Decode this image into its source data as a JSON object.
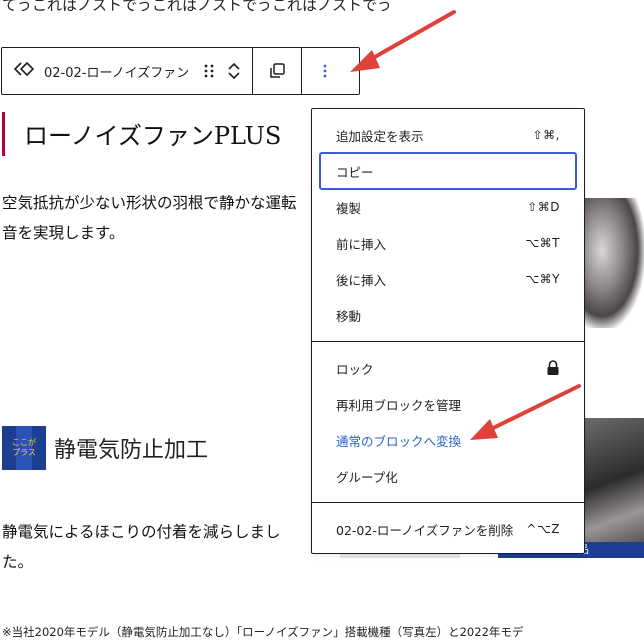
{
  "content": {
    "top_text": "てうこれはノストでうこれはノストでうこれはノストでう",
    "heading": "ローノイズファンPLUS",
    "paragraph1": "空気抵抗が少ない形状の羽根で静かな運転音を実現します。",
    "badge_text": [
      "ここが",
      "プラス"
    ],
    "sub_heading": "静電気防止加工",
    "paragraph2": "静電気によるほこりの付着を減らしました。",
    "footnote": "※当社2020年モデル（静電気防止加工なし）「ローノイズファン」搭載機種（写真左）と2022年モデ",
    "photo_label": "品"
  },
  "toolbar": {
    "block_label": "02-02-ローノイズファン"
  },
  "menu": {
    "group1": [
      {
        "label": "追加設定を表示",
        "shortcut": "⇧⌘,"
      },
      {
        "label": "コピー",
        "shortcut": ""
      },
      {
        "label": "複製",
        "shortcut": "⇧⌘D"
      },
      {
        "label": "前に挿入",
        "shortcut": "⌥⌘T"
      },
      {
        "label": "後に挿入",
        "shortcut": "⌥⌘Y"
      },
      {
        "label": "移動",
        "shortcut": ""
      }
    ],
    "group2": [
      {
        "label": "ロック",
        "icon": "lock-icon"
      },
      {
        "label": "再利用ブロックを管理"
      },
      {
        "label": "通常のブロックへ変換"
      },
      {
        "label": "グループ化"
      }
    ],
    "group3": [
      {
        "label": "02-02-ローノイズファンを削除",
        "shortcut": "^⌥Z"
      }
    ]
  },
  "colors": {
    "accent": "#3858e9",
    "link": "#2962c8",
    "arrow": "#e0403a",
    "heading_bar": "#b3003c",
    "badge": "#1c3f91"
  }
}
